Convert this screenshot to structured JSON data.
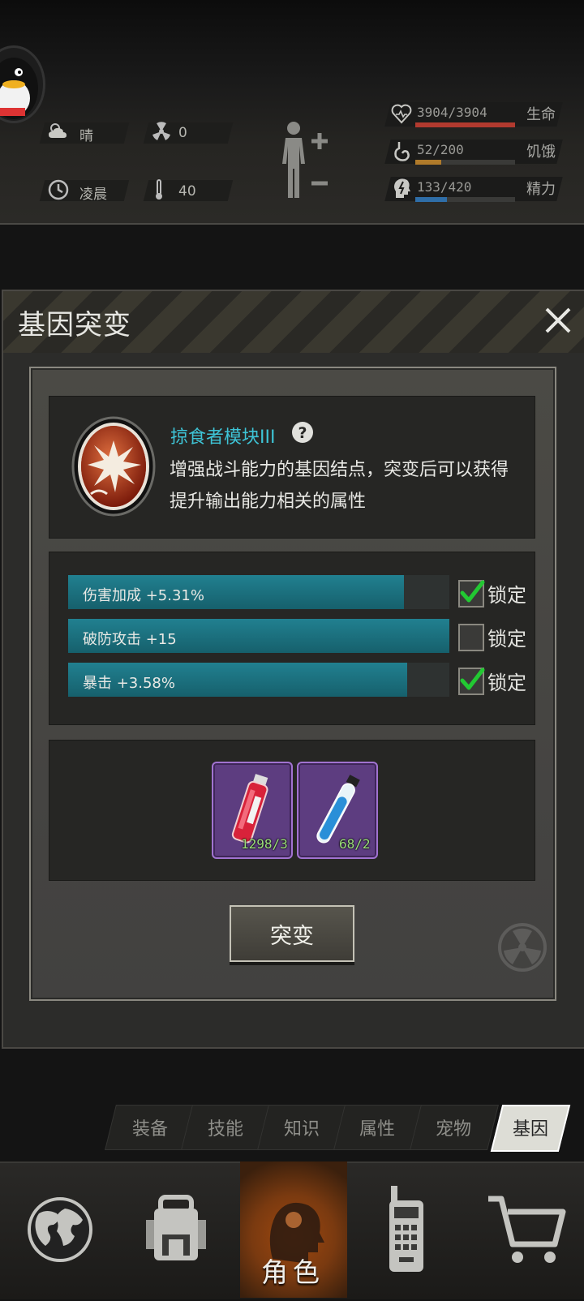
{
  "environment": {
    "weather": "晴",
    "radiation": "0",
    "time_of_day": "凌晨",
    "temperature": "40"
  },
  "stats": [
    {
      "value": "3904/3904",
      "label": "生命",
      "fill": 1.0,
      "color": "#b23a2f",
      "icon": "heart-icon"
    },
    {
      "value": "52/200",
      "label": "饥饿",
      "fill": 0.26,
      "color": "#b07a2a",
      "icon": "stomach-icon"
    },
    {
      "value": "133/420",
      "label": "精力",
      "fill": 0.32,
      "color": "#2f6ea8",
      "icon": "energy-head-icon"
    }
  ],
  "dialog": {
    "title": "基因突变",
    "gene": {
      "name": "掠食者模块III",
      "description_line1": "增强战斗能力的基因结点，突变后可以获得",
      "description_line2": "提升输出能力相关的属性",
      "icon": "predator-gene-icon"
    },
    "attributes": [
      {
        "text": "伤害加成 +5.31%",
        "fill": 0.88,
        "locked": true
      },
      {
        "text": "破防攻击 +15",
        "fill": 1.0,
        "locked": false
      },
      {
        "text": "暴击 +3.58%",
        "fill": 0.89,
        "locked": true
      }
    ],
    "lock_label": "锁定",
    "items": [
      {
        "name": "red-serum-vial",
        "count": "1298/3"
      },
      {
        "name": "blue-serum-tube",
        "count": "68/2"
      }
    ],
    "mutate_label": "突变"
  },
  "tabs": [
    {
      "label": "装备",
      "active": false
    },
    {
      "label": "技能",
      "active": false
    },
    {
      "label": "知识",
      "active": false
    },
    {
      "label": "属性",
      "active": false
    },
    {
      "label": "宠物",
      "active": false
    },
    {
      "label": "基因",
      "active": true
    }
  ],
  "bottom_nav": {
    "active_label": "角色",
    "items": [
      "globe-icon",
      "backpack-icon",
      "character-head-icon",
      "radio-icon",
      "cart-icon"
    ]
  }
}
